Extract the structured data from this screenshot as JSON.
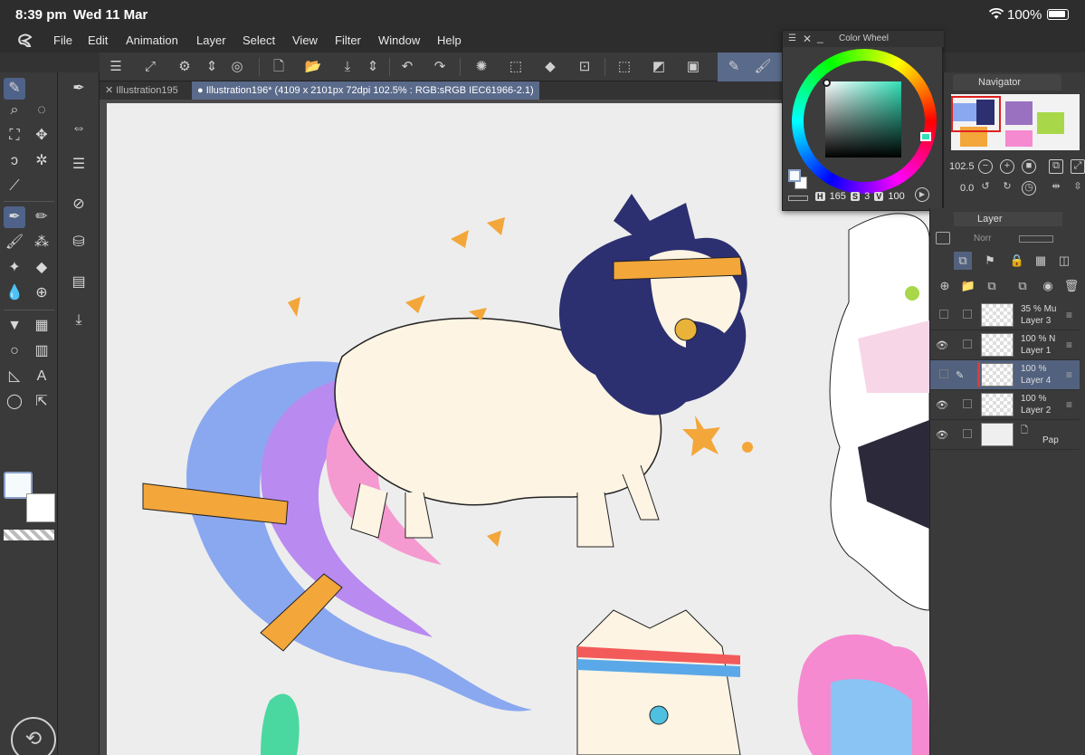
{
  "status": {
    "time": "8:39 pm",
    "date": "Wed 11 Mar",
    "battery": "100%"
  },
  "menu": [
    "File",
    "Edit",
    "Animation",
    "Layer",
    "Select",
    "View",
    "Filter",
    "Window",
    "Help"
  ],
  "tabs": [
    {
      "label": "Illustration195",
      "active": false
    },
    {
      "label": "Illustration196* (4109 x 2101px 72dpi 102.5% : RGB:sRGB IEC61966-2.1)",
      "active": true
    }
  ],
  "color_wheel": {
    "title": "Color Wheel",
    "h_label": "H",
    "h": "165",
    "s_label": "S",
    "s": "3",
    "v_label": "V",
    "v": "100",
    "hue_color": "#33e0b8",
    "main_color": "#f5fbfd",
    "sub_color": "#ffffff"
  },
  "navigator": {
    "title": "Navigator",
    "zoom": "102.5",
    "rotation": "0.0"
  },
  "layers": {
    "title": "Layer",
    "blend_mode": "Norr",
    "items": [
      {
        "opacity": "35 %",
        "mode": "Mu",
        "name": "Layer 3",
        "visible": false,
        "selected": false
      },
      {
        "opacity": "100 %",
        "mode": "N",
        "name": "Layer 1",
        "visible": true,
        "selected": false
      },
      {
        "opacity": "100 %",
        "mode": "",
        "name": "Layer 4",
        "visible": false,
        "selected": true
      },
      {
        "opacity": "100 %",
        "mode": "",
        "name": "Layer 2",
        "visible": true,
        "selected": false
      },
      {
        "opacity": "",
        "mode": "",
        "name": "Pap",
        "visible": true,
        "selected": false
      }
    ]
  }
}
